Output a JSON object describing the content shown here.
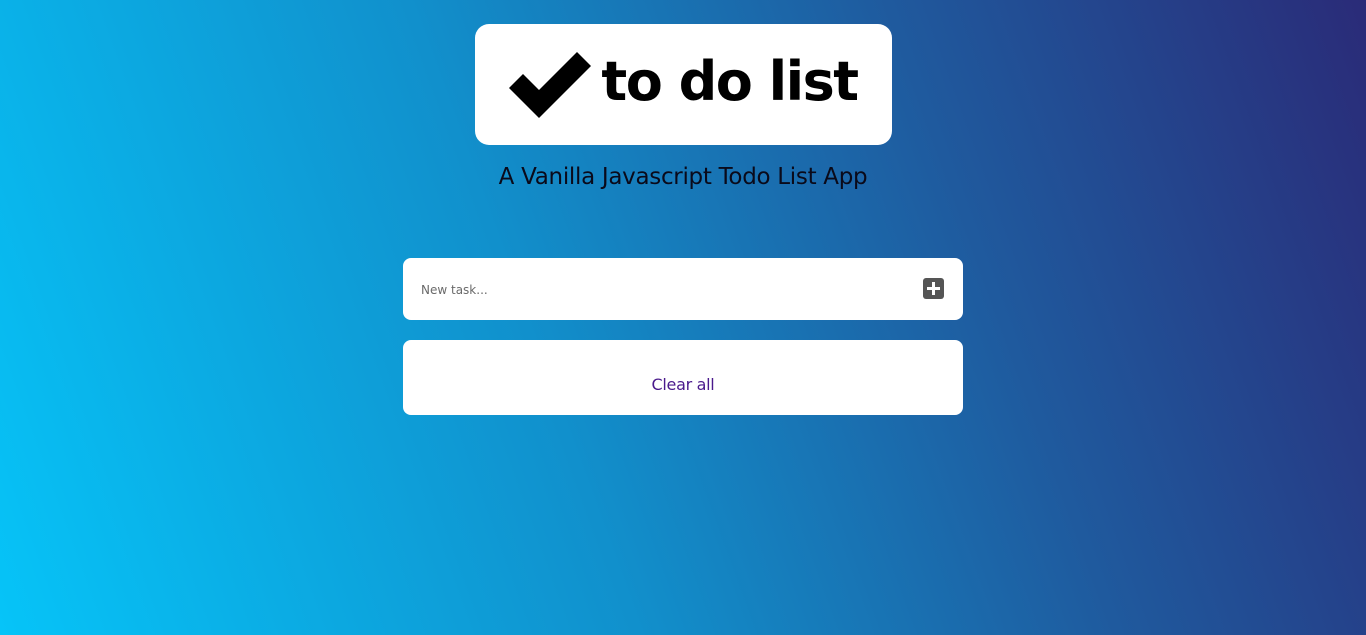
{
  "header": {
    "logo_text": "to do list",
    "subtitle": "A Vanilla Javascript Todo List App"
  },
  "new_task": {
    "placeholder": "New task...",
    "value": "",
    "add_icon": "plus-icon"
  },
  "list": {
    "items": [],
    "clear_all_label": "Clear all"
  },
  "colors": {
    "gradient_start": "#06c4f8",
    "gradient_end": "#2a2b78",
    "clear_all": "#4a1a8c",
    "add_button": "#555555"
  }
}
